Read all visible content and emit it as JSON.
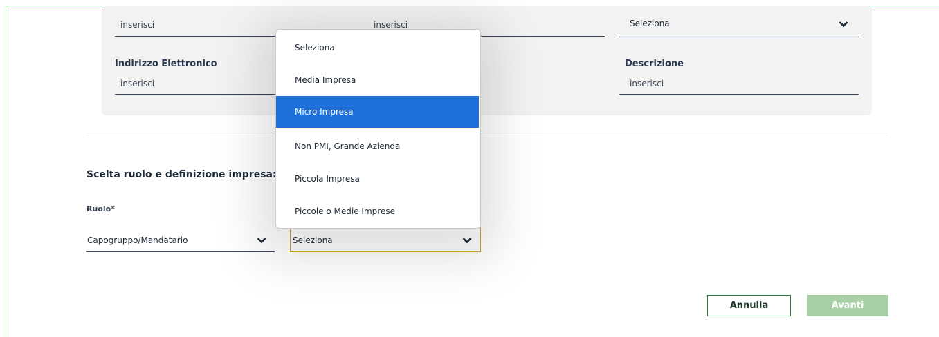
{
  "top_row": {
    "field1_placeholder": "inserisci",
    "field2_placeholder": "inserisci",
    "field3_value": "Seleziona"
  },
  "second_row": {
    "email_label": "Indirizzo Elettronico",
    "email_placeholder": "inserisci",
    "description_label": "Descrizione",
    "description_placeholder": "inserisci"
  },
  "section": {
    "title": "Scelta ruolo e definizione impresa:",
    "role_label": "Ruolo*",
    "role_value": "Capogruppo/Mandatario",
    "company_type_value": "Seleziona"
  },
  "dropdown": {
    "options": [
      "Seleziona",
      "Media Impresa",
      "Micro Impresa",
      "Non PMI, Grande Azienda",
      "Piccola Impresa",
      "Piccole o Medie Imprese"
    ],
    "highlighted": "Micro Impresa"
  },
  "buttons": {
    "cancel": "Annulla",
    "next": "Avanti"
  },
  "colors": {
    "highlight": "#1e6fd9",
    "frame": "#2e8b3d",
    "focus_border": "#e0a020",
    "next_button": "#a8cfa5"
  },
  "icons": {
    "chevron": "chevron-down-icon"
  }
}
